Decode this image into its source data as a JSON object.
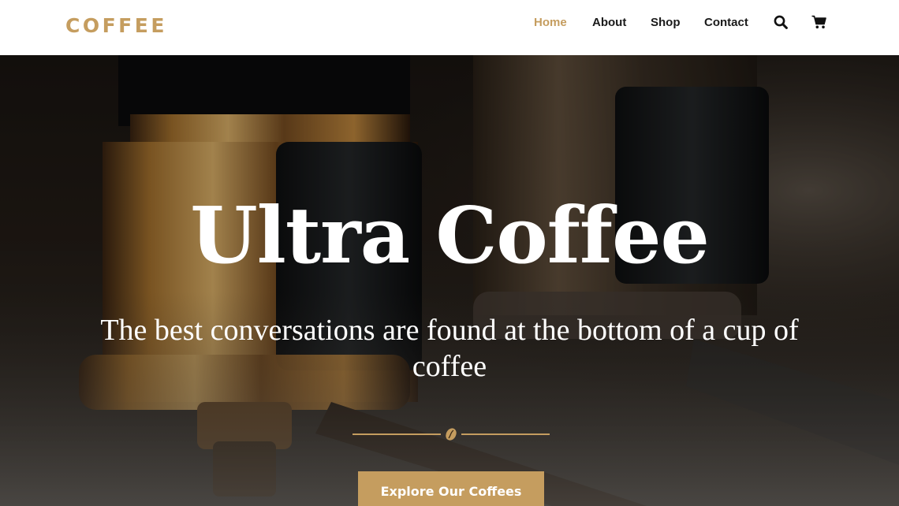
{
  "brand": {
    "logo_text": "COFFEE",
    "accent_color": "#c59d5f"
  },
  "nav": {
    "items": [
      {
        "label": "Home",
        "active": true
      },
      {
        "label": "About",
        "active": false
      },
      {
        "label": "Shop",
        "active": false
      },
      {
        "label": "Contact",
        "active": false
      }
    ],
    "icons": [
      "search-icon",
      "cart-icon"
    ]
  },
  "hero": {
    "title": "Ultra Coffee",
    "subtitle": "The best conversations are found at the bottom of a cup of coffee",
    "divider_icon": "coffee-bean-icon",
    "cta_label": "Explore Our Coffees"
  }
}
